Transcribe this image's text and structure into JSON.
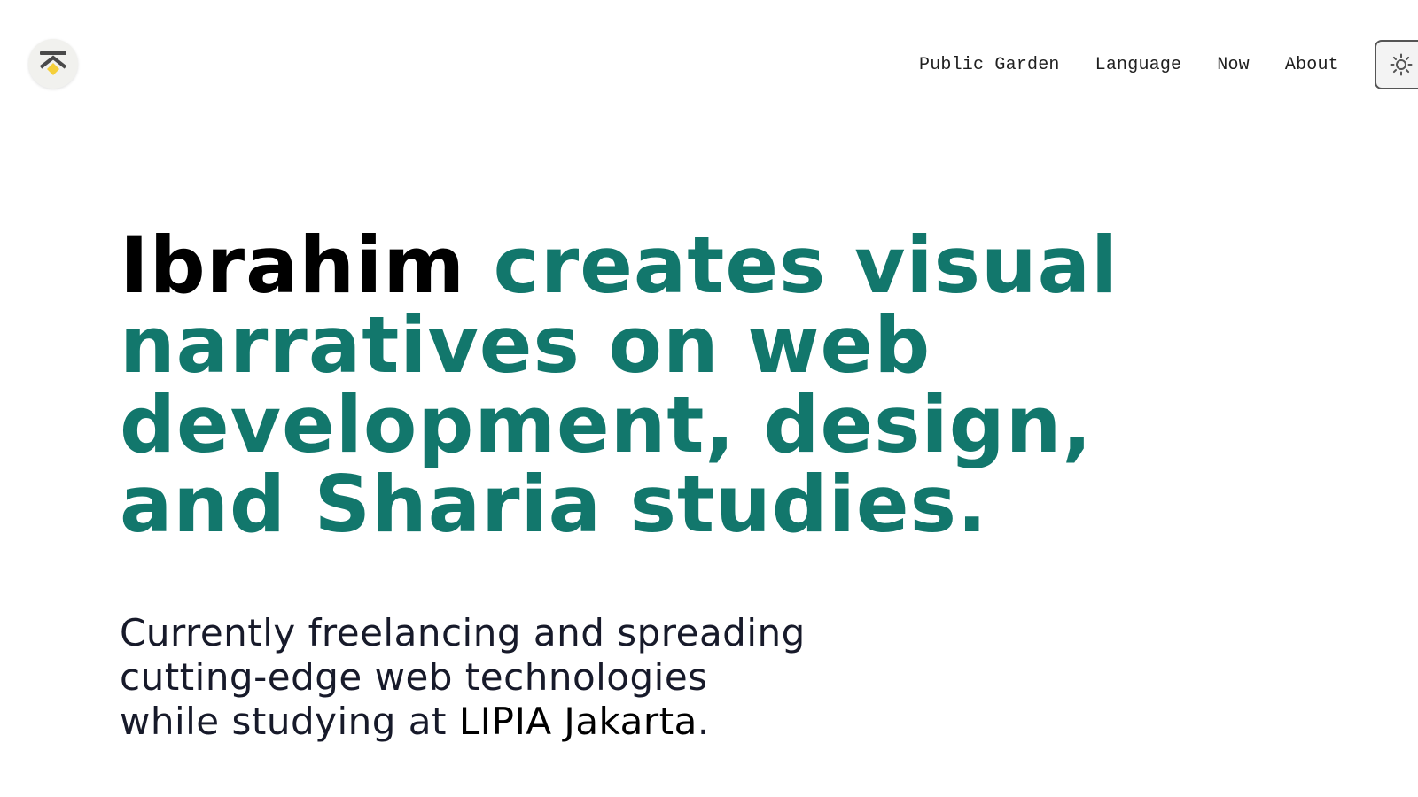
{
  "logo": {
    "icon": "chevron-diamond-logo-icon",
    "colors": {
      "chevron": "#4a4a4a",
      "diamond": "#f5cf3a"
    }
  },
  "nav": {
    "items": [
      {
        "label": "Public Garden"
      },
      {
        "label": "Language"
      },
      {
        "label": "Now"
      },
      {
        "label": "About"
      }
    ],
    "theme_toggle_icon": "sun-icon"
  },
  "hero": {
    "name": "Ibrahim",
    "tagline": "creates visual narratives on web development, design, and Sharia studies."
  },
  "intro": {
    "line1": "Currently freelancing and spreading",
    "line2": "cutting-edge web technologies",
    "line3_prefix": "while studying at ",
    "place": "LIPIA Jakarta",
    "line3_suffix": "."
  },
  "colors": {
    "accent": "#12776c",
    "text": "#171a2a",
    "name": "#000000"
  }
}
